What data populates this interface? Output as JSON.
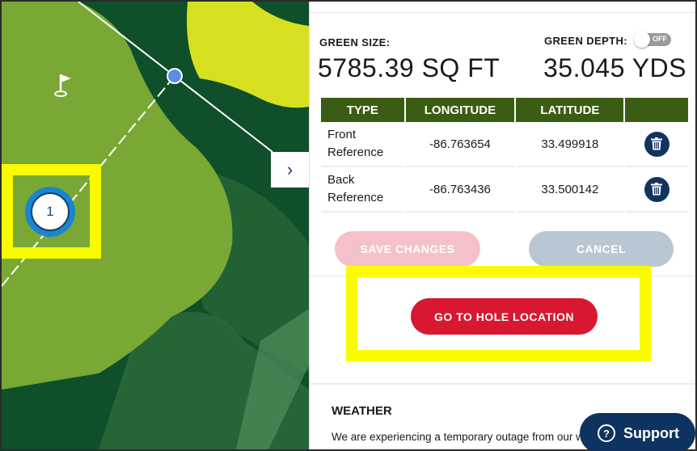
{
  "map": {
    "hole_marker_label": "1",
    "collapse_icon": "chevron-right-icon",
    "flag_icon": "flag-icon",
    "colors": {
      "green": "#79a834",
      "rough": "#0f4f2a",
      "bunker": "#d6e021",
      "highlight": "#fbfb00",
      "handle": "#5b8ee8"
    }
  },
  "panel": {
    "green_size": {
      "label": "GREEN SIZE:",
      "value": "5785.39 SQ FT"
    },
    "green_depth": {
      "label": "GREEN DEPTH:",
      "value": "35.045 YDS",
      "toggle_label": "OFF",
      "toggle_on": false
    },
    "table": {
      "headers": [
        "TYPE",
        "LONGITUDE",
        "LATITUDE",
        ""
      ],
      "rows": [
        {
          "type_line1": "Front",
          "type_line2": "Reference",
          "longitude": "-86.763654",
          "latitude": "33.499918",
          "action_icon": "trash-icon"
        },
        {
          "type_line1": "Back",
          "type_line2": "Reference",
          "longitude": "-86.763436",
          "latitude": "33.500142",
          "action_icon": "trash-icon"
        }
      ]
    },
    "buttons": {
      "save": "SAVE CHANGES",
      "cancel": "CANCEL",
      "go_to_hole": "GO TO HOLE LOCATION"
    },
    "weather": {
      "title": "WEATHER",
      "text": "We are experiencing a temporary outage from our w"
    },
    "support": {
      "label": "Support",
      "icon": "question-circle-icon"
    },
    "colors": {
      "header_green": "#3d5c13",
      "primary_red": "#d81830",
      "navy": "#12335e"
    }
  }
}
